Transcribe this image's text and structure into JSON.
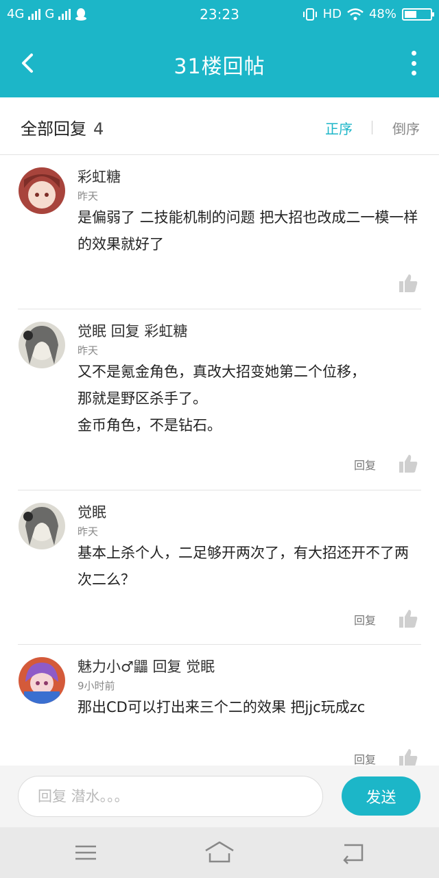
{
  "status_bar": {
    "network_1": "4G",
    "network_2": "G",
    "time": "23:23",
    "hd": "HD",
    "battery": "48%",
    "battery_level": 0.48
  },
  "header": {
    "title": "31楼回帖",
    "back_icon": "chevron-left-icon",
    "more_icon": "more-vertical-icon"
  },
  "sort_bar": {
    "heading": "全部回复",
    "count": "4",
    "asc_label": "正序",
    "desc_label": "倒序"
  },
  "replies": [
    {
      "author": "彩虹糖",
      "time": "昨天",
      "content": "是偏弱了 二技能机制的问题 把大招也改成二一模一样的效果就好了",
      "reply_label": "",
      "avatar_colors": [
        "#b0504a",
        "#f4d2c4"
      ]
    },
    {
      "author": "觉眠 回复 彩虹糖",
      "time": "昨天",
      "content_lines": [
        "又不是氪金角色，真改大招变她第二个位移，",
        "那就是野区杀手了。",
        "金币角色，不是钻石。"
      ],
      "reply_label": "回复",
      "avatar_colors": [
        "#5a5a5a",
        "#e6e2d6"
      ]
    },
    {
      "author": "觉眠",
      "time": "昨天",
      "content": "基本上杀个人，二足够开两次了，有大招还开不了两次二么？",
      "reply_label": "回复",
      "avatar_colors": [
        "#5a5a5a",
        "#e6e2d6"
      ]
    },
    {
      "author": "魅力小♂鼺 回复 觉眠",
      "time": "9小时前",
      "content": "那出CD可以打出来三个二的效果 把jjc玩成zc",
      "reply_label": "回复",
      "avatar_colors": [
        "#7a4fbf",
        "#f2c9d6"
      ]
    }
  ],
  "input_bar": {
    "placeholder": "回复 潜水。。。",
    "send_label": "发送"
  },
  "nav_bar": {
    "icons": [
      "menu-icon",
      "home-icon",
      "back-icon"
    ]
  },
  "colors": {
    "accent": "#1cb6c8"
  }
}
